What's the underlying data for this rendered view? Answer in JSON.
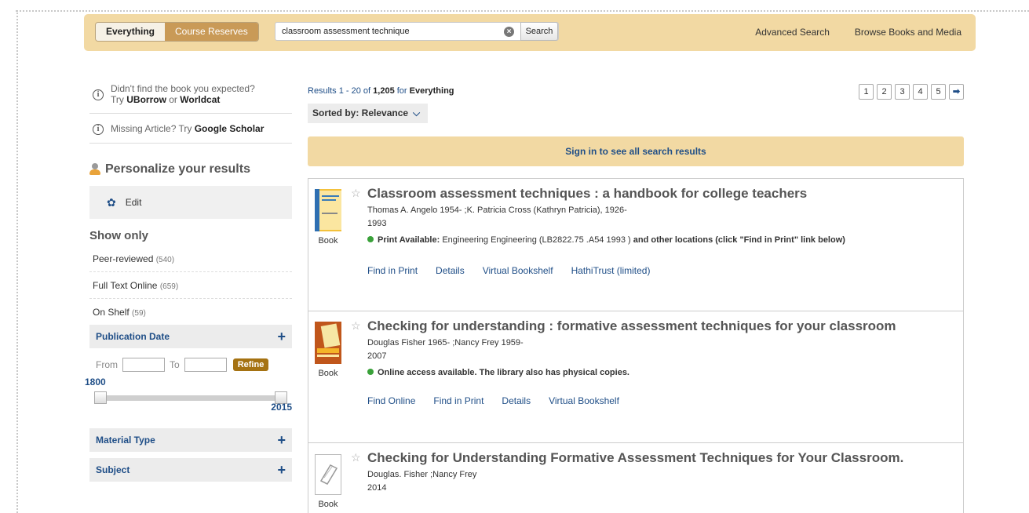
{
  "search": {
    "scope_everything": "Everything",
    "scope_reserves": "Course Reserves",
    "query": "classroom assessment technique",
    "search_label": "Search",
    "advanced_label": "Advanced Search",
    "browse_label": "Browse Books and Media"
  },
  "sidebar": {
    "note1_line1": "Didn't find the book you expected?",
    "note1_try": "Try",
    "note1_uborrow": "UBorrow",
    "note1_or": "or",
    "note1_worldcat": "Worldcat",
    "note2_text": "Missing Article? Try",
    "note2_link": "Google Scholar",
    "personalize": "Personalize your results",
    "edit": "Edit",
    "show_only": "Show only",
    "filters": [
      {
        "label": "Peer-reviewed",
        "count": "(540)"
      },
      {
        "label": "Full Text Online",
        "count": "(659)"
      },
      {
        "label": "On Shelf",
        "count": "(59)"
      }
    ],
    "pub_date": "Publication Date",
    "from": "From",
    "to": "To",
    "refine": "Refine",
    "slider_low": "1800",
    "slider_high": "2015",
    "material_type": "Material Type",
    "subject": "Subject"
  },
  "results_header": {
    "range": "Results 1 - 20 of",
    "total": "1,205",
    "for": "for",
    "scope": "Everything",
    "sorted_by": "Sorted by: Relevance",
    "pages": [
      "1",
      "2",
      "3",
      "4",
      "5"
    ],
    "signin": "Sign in to see all search results"
  },
  "records": [
    {
      "type": "Book",
      "title": "Classroom assessment techniques : a handbook for college teachers",
      "authors": "Thomas A. Angelo 1954- ;K. Patricia Cross (Kathryn Patricia), 1926-",
      "year": "1993",
      "avail_bold": "Print Available:",
      "avail_text": "Engineering Engineering (LB2822.75 .A54 1993 )",
      "avail_tail": "and other locations (click \"Find in Print\" link below)",
      "links": [
        "Find in Print",
        "Details",
        "Virtual Bookshelf",
        "HathiTrust (limited)"
      ],
      "status_color": "#3aa13a"
    },
    {
      "type": "Book",
      "title": "Checking for understanding : formative assessment techniques for your classroom",
      "authors": "Douglas Fisher 1965- ;Nancy Frey 1959-",
      "year": "2007",
      "avail_bold": "Online access available. The library also has physical copies.",
      "links": [
        "Find Online",
        "Find in Print",
        "Details",
        "Virtual Bookshelf"
      ],
      "status_color": "#3aa13a"
    },
    {
      "type": "Book",
      "title": "Checking for Understanding Formative Assessment Techniques for Your Classroom.",
      "authors": "Douglas. Fisher ;Nancy Frey",
      "year": "2014"
    }
  ],
  "colors": {
    "accent": "#f2d9a3",
    "link": "#1f4e87",
    "reserve": "#c99a57",
    "refine": "#a57212"
  }
}
